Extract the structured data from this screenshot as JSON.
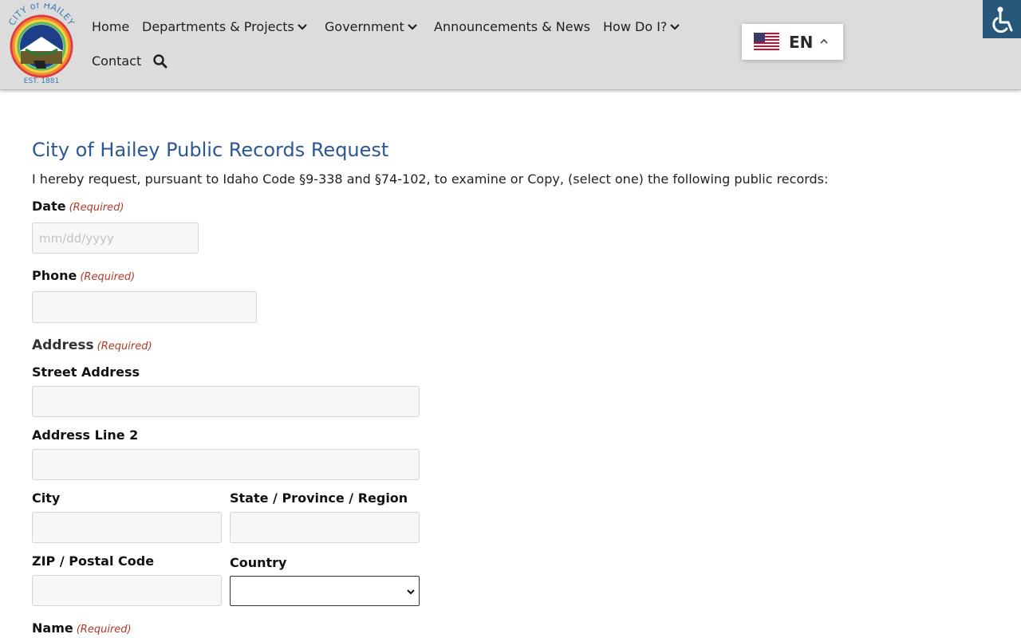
{
  "header": {
    "logo_text": "CITY of HAILEY",
    "logo_est": "EST. 1881",
    "nav": {
      "home": "Home",
      "departments": "Departments & Projects",
      "government": "Government",
      "announcements": "Announcements & News",
      "howdoi": "How Do I?",
      "contact": "Contact"
    },
    "language": {
      "code": "EN"
    }
  },
  "form": {
    "title": "City of Hailey Public Records Request",
    "intro": "I hereby request, pursuant to Idaho Code §9-338 and §74-102, to examine or Copy, (select one) the following public records:",
    "required_text": "(Required)",
    "date": {
      "label": "Date",
      "placeholder": "mm/dd/yyyy",
      "value": ""
    },
    "phone": {
      "label": "Phone",
      "value": ""
    },
    "address": {
      "legend": "Address",
      "street_label": "Street Address",
      "line2_label": "Address Line 2",
      "city_label": "City",
      "state_label": "State / Province / Region",
      "zip_label": "ZIP / Postal Code",
      "country_label": "Country",
      "country_value": ""
    },
    "name": {
      "label": "Name"
    }
  },
  "icons": [
    "logo-seal",
    "chevron-down-icon",
    "search-icon",
    "us-flag-icon",
    "chevron-up-icon",
    "accessibility-icon"
  ]
}
